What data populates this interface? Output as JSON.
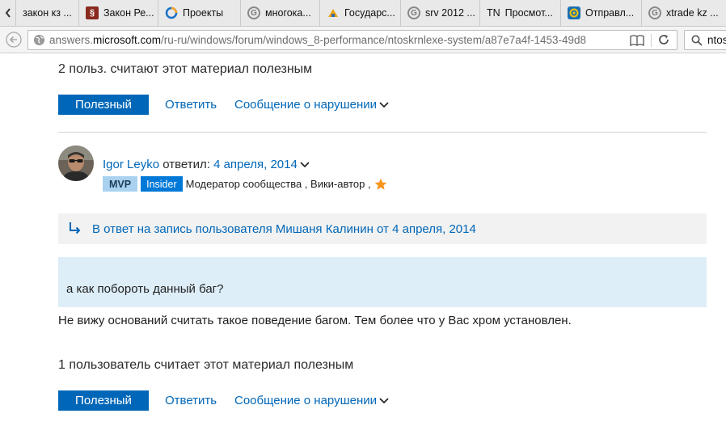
{
  "browser": {
    "tabs": [
      {
        "label": "закон кз ...",
        "icon": "google-icon"
      },
      {
        "label": "Закон Ре...",
        "icon": "zakon-icon"
      },
      {
        "label": "Проекты",
        "icon": "projects-icon"
      },
      {
        "label": "многока...",
        "icon": "google-icon"
      },
      {
        "label": "Государс...",
        "icon": "gov-icon"
      },
      {
        "label": "srv 2012 ...",
        "icon": "google-icon"
      },
      {
        "label": "Просмот...",
        "icon": "tn-icon",
        "prefix": "TN"
      },
      {
        "label": "Отправл...",
        "icon": "mail-icon"
      },
      {
        "label": "xtrade kz ...",
        "icon": "google-icon"
      }
    ],
    "url_prefix": "answers.",
    "url_domain": "microsoft.com",
    "url_path": "/ru-ru/windows/forum/windows_8-performance/ntoskrnlexe-system/a87e7a4f-1453-49d8",
    "search_text": "ntos"
  },
  "post_top": {
    "helpful_count_text": "2 польз. считают этот материал полезным",
    "helpful_button": "Полезный",
    "reply_link": "Ответить",
    "report_link": "Сообщение о нарушении"
  },
  "reply": {
    "author_name": "Igor Leyko",
    "answered_text": " ответил: ",
    "date": "4 апреля, 2014",
    "badge_mvp": "MVP",
    "badge_insider": "Insider",
    "roles": "Модератор сообщества , Вики-автор ,",
    "in_reply_to": "В ответ на запись пользователя Мишаня Калинин от 4 апреля, 2014",
    "quote": "а как побороть данный баг?",
    "body": "Не вижу оснований считать такое поведение багом. Тем более что у Вас хром установлен."
  },
  "post_bottom": {
    "helpful_count_text": "1 пользователь считает этот материал полезным",
    "helpful_button": "Полезный",
    "reply_link": "Ответить",
    "report_link": "Сообщение о нарушении"
  },
  "colors": {
    "accent": "#0067b8",
    "quote_bg": "#ddeef9",
    "reply_bg": "#f2f2f2",
    "star": "#f7941d"
  }
}
